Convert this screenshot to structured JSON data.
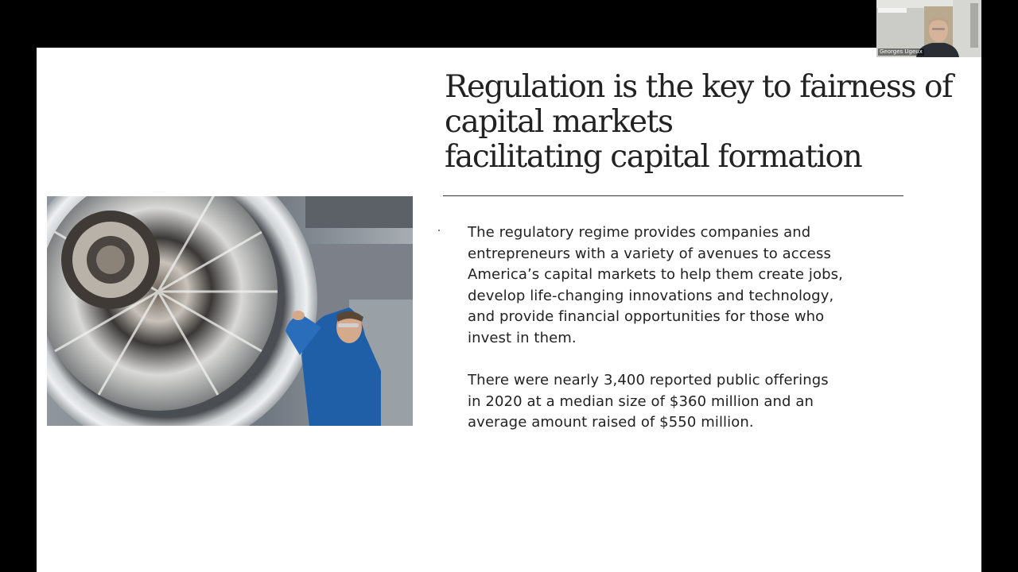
{
  "slide": {
    "title_lines": [
      "Regulation is the key to fairness of",
      "capital markets",
      "facilitating capital formation"
    ],
    "paragraphs": [
      {
        "lines": [
          "The regulatory regime provides companies and",
          "entrepreneurs with a variety of avenues to access",
          "America’s capital markets to help them create jobs,",
          "develop life-changing innovations and technology,",
          "and provide financial opportunities for those who",
          "invest in them."
        ]
      },
      {
        "lines": [
          "There were nearly 3,400 reported public offerings",
          "in 2020 at a median size of $360 million and an",
          "average amount raised of $550 million."
        ]
      }
    ],
    "image": {
      "subject": "jet-engine-technician-photo"
    }
  },
  "video_call": {
    "participant_name": "Georges Ugeux"
  },
  "colors": {
    "screen_background": "#000000",
    "slide_background": "#ffffff",
    "text": "#222222",
    "technician_shirt": "#1f5fa8"
  }
}
